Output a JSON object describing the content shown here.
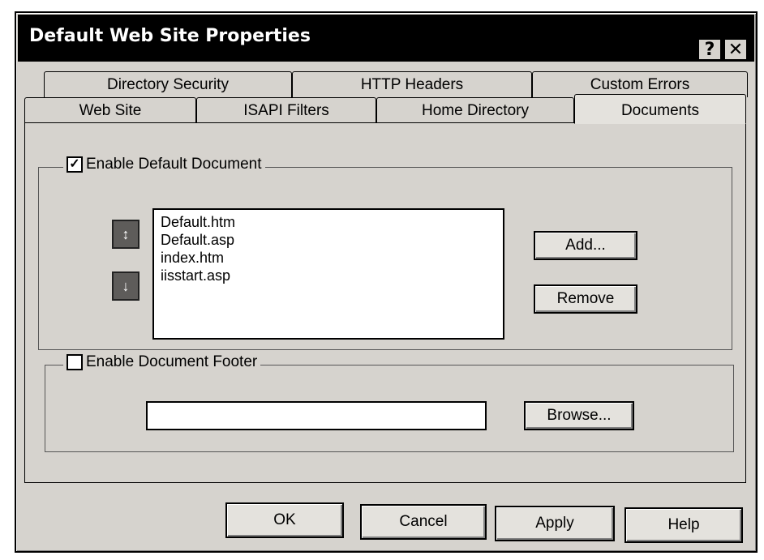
{
  "window": {
    "title": "Default Web Site Properties",
    "help_glyph": "?",
    "close_glyph": "✕"
  },
  "tabs_back": [
    {
      "label": "Directory Security"
    },
    {
      "label": "HTTP Headers"
    },
    {
      "label": "Custom Errors"
    }
  ],
  "tabs_front": [
    {
      "label": "Web Site"
    },
    {
      "label": "ISAPI Filters"
    },
    {
      "label": "Home Directory"
    },
    {
      "label": "Documents"
    }
  ],
  "default_doc": {
    "check_mark": "✓",
    "label": "Enable Default Document",
    "move_up_glyph": "↕",
    "move_down_glyph": "↓",
    "items": [
      "Default.htm",
      "Default.asp",
      "index.htm",
      "iisstart.asp"
    ],
    "add_label": "Add...",
    "remove_label": "Remove"
  },
  "footer": {
    "label": "Enable Document Footer",
    "value": "",
    "browse_label": "Browse..."
  },
  "buttons": {
    "ok": "OK",
    "cancel": "Cancel",
    "apply": "Apply",
    "help": "Help"
  },
  "colors": {
    "face": "#d6d3ce",
    "title": "#000000"
  }
}
